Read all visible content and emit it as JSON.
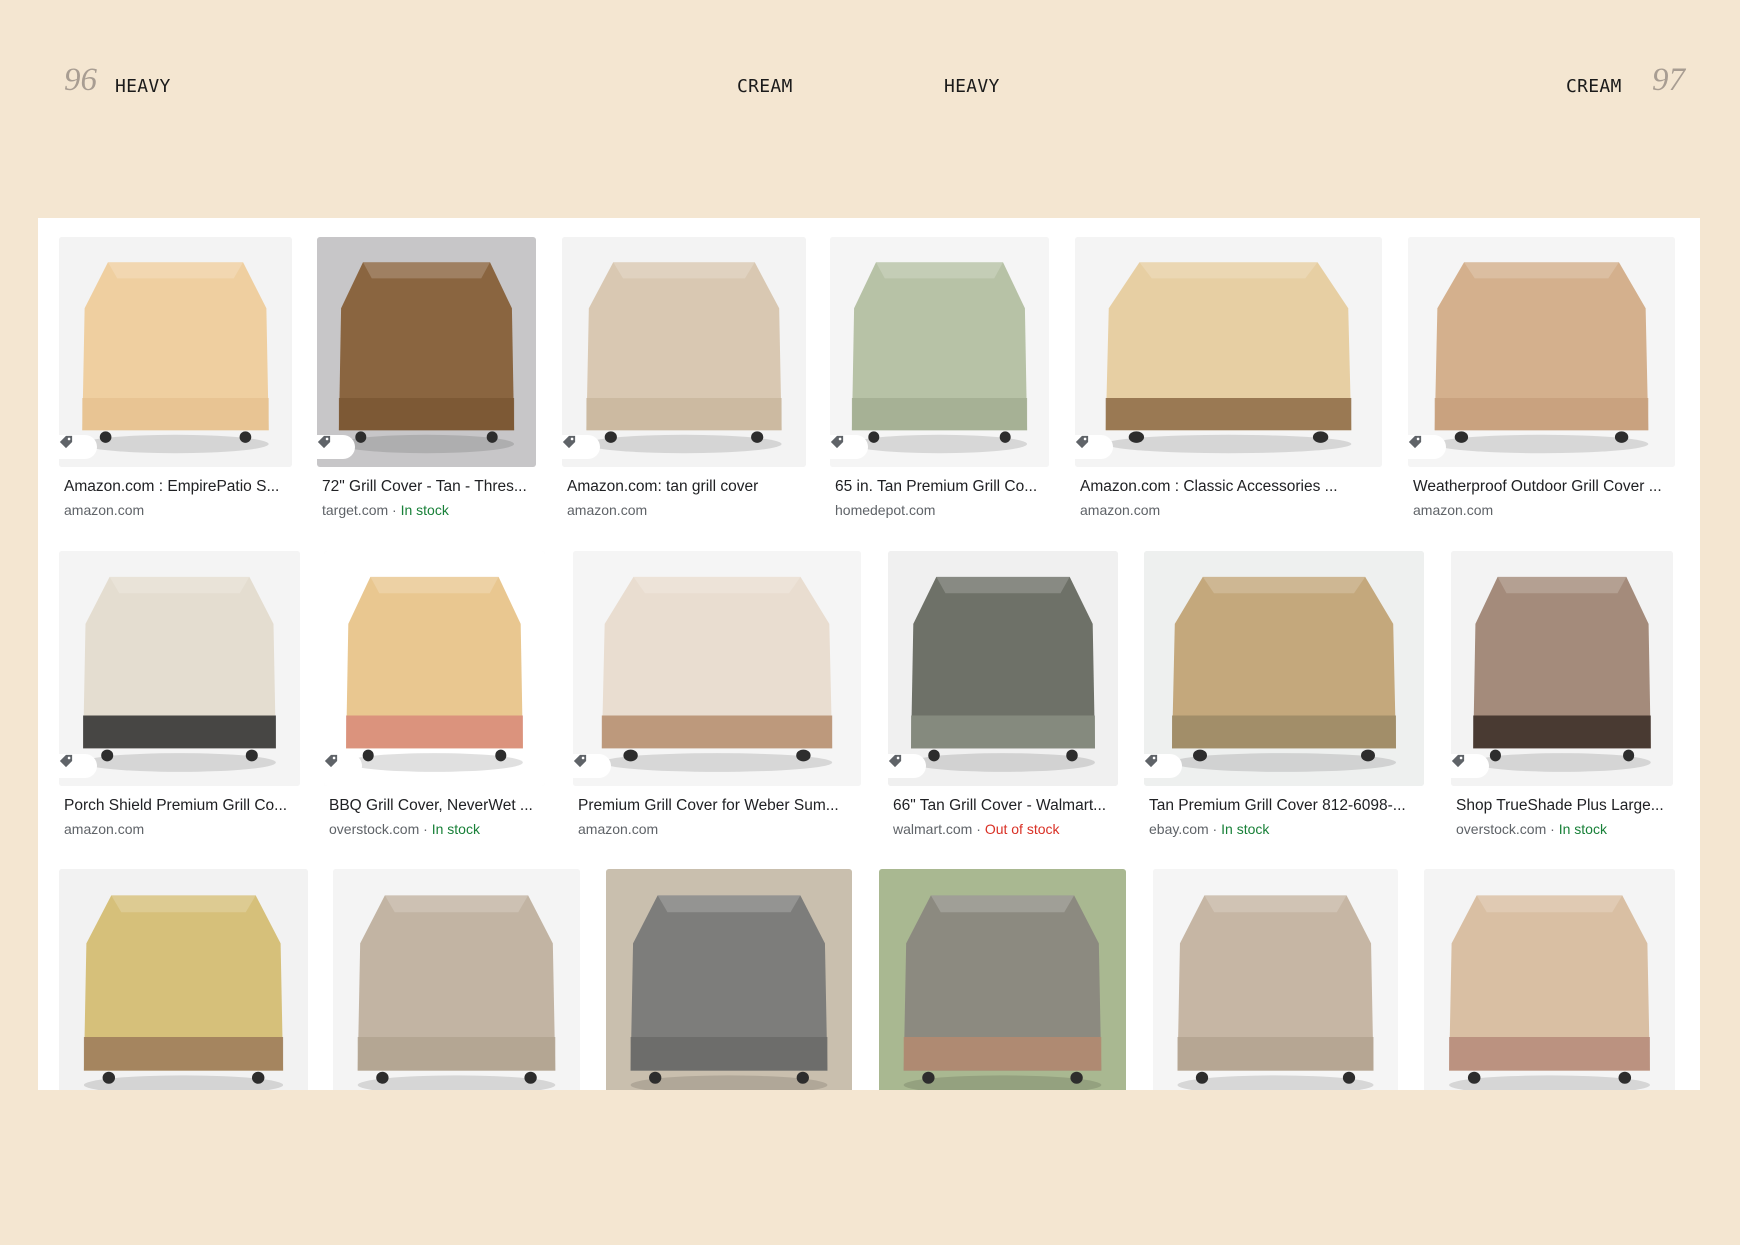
{
  "spread": {
    "left_page_number": "96",
    "left_heading_1": "HEAVY",
    "left_heading_2": "CREAM",
    "right_heading_1": "HEAVY",
    "right_heading_2": "CREAM",
    "right_page_number": "97"
  },
  "results": {
    "row1": [
      {
        "title": "Amazon.com : EmpirePatio S...",
        "source": "amazon.com",
        "stock": "",
        "stock_status": "",
        "bg": "#f3f3f3",
        "cover": "#efcfa0",
        "trim": "#e6c290"
      },
      {
        "title": "72\" Grill Cover - Tan - Thres...",
        "source": "target.com",
        "stock": "In stock",
        "stock_status": "ok",
        "bg": "#c7c6c8",
        "cover": "#8a6540",
        "trim": "#7a5734"
      },
      {
        "title": "Amazon.com: tan grill cover",
        "source": "amazon.com",
        "stock": "",
        "stock_status": "",
        "bg": "#f3f3f3",
        "cover": "#d9c8b2",
        "trim": "#c9b79e"
      },
      {
        "title": "65 in. Tan Premium Grill Co...",
        "source": "homedepot.com",
        "stock": "",
        "stock_status": "",
        "bg": "#f5f5f5",
        "cover": "#b7c2a6",
        "trim": "#a3ae92"
      },
      {
        "title": "Amazon.com : Classic Accessories ...",
        "source": "amazon.com",
        "stock": "",
        "stock_status": "",
        "bg": "#f4f4f4",
        "cover": "#e7cfa3",
        "trim": "#8c6a45"
      },
      {
        "title": "Weatherproof Outdoor Grill Cover ...",
        "source": "amazon.com",
        "stock": "",
        "stock_status": "",
        "bg": "#f5f5f5",
        "cover": "#d4b08d",
        "trim": "#c7a07c"
      }
    ],
    "row2": [
      {
        "title": "Porch Shield Premium Grill Co...",
        "source": "amazon.com",
        "stock": "",
        "stock_status": "",
        "bg": "#f4f4f4",
        "cover": "#e4ddd0",
        "trim": "#2b2b2b"
      },
      {
        "title": "BBQ Grill Cover, NeverWet ...",
        "source": "overstock.com",
        "stock": "In stock",
        "stock_status": "ok",
        "bg": "#ffffff",
        "cover": "#e9c790",
        "trim": "#d88a7a"
      },
      {
        "title": "Premium Grill Cover for Weber Sum...",
        "source": "amazon.com",
        "stock": "",
        "stock_status": "",
        "bg": "#f5f5f5",
        "cover": "#e9ddd0",
        "trim": "#b58d6d"
      },
      {
        "title": "66\" Tan Grill Cover - Walmart...",
        "source": "walmart.com",
        "stock": "Out of stock",
        "stock_status": "bad",
        "bg": "#f0f0f0",
        "cover": "#6e7168",
        "trim": "#8a8e83"
      },
      {
        "title": "Tan Premium Grill Cover 812-6098-...",
        "source": "ebay.com",
        "stock": "In stock",
        "stock_status": "ok",
        "bg": "#eef0ef",
        "cover": "#c4a87c",
        "trim": "#9c8a66"
      },
      {
        "title": "Shop TrueShade Plus Large...",
        "source": "overstock.com",
        "stock": "In stock",
        "stock_status": "ok",
        "bg": "#f3f3f3",
        "cover": "#a48b7b",
        "trim": "#3a2c26"
      }
    ],
    "row3": [
      {
        "bg": "#f2f2f2",
        "cover": "#d6c07a",
        "trim": "#9c7a5b"
      },
      {
        "bg": "#f4f4f4",
        "cover": "#c2b4a3",
        "trim": "#b1a391"
      },
      {
        "bg": "#c9bfae",
        "cover": "#7d7d7b",
        "trim": "#6a6a68"
      },
      {
        "bg": "#a9b891",
        "cover": "#8c8a80",
        "trim": "#b58a70"
      },
      {
        "bg": "#f5f5f5",
        "cover": "#c6b6a4",
        "trim": "#b3a390"
      },
      {
        "bg": "#f4f4f4",
        "cover": "#d9bfa3",
        "trim": "#b58a7a"
      }
    ]
  },
  "icons": {
    "tag": "price-tag-icon"
  }
}
